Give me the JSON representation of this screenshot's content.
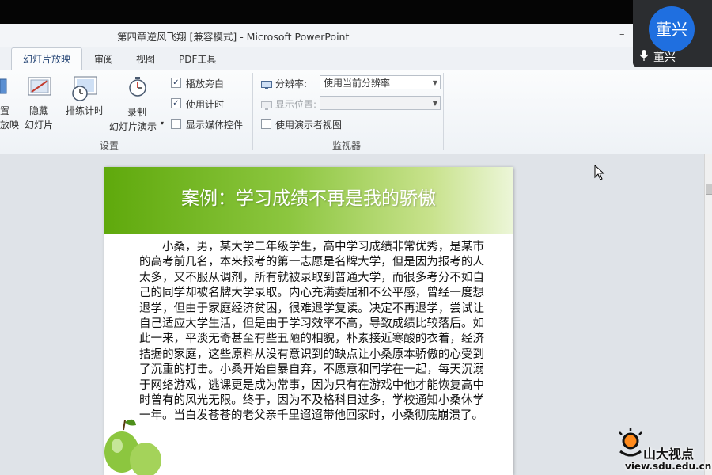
{
  "window": {
    "title": "第四章逆风飞翔 [兼容模式] - Microsoft PowerPoint",
    "minimize": "–",
    "close": "✕"
  },
  "tabs": [
    "幻灯片放映",
    "审阅",
    "视图",
    "PDF工具"
  ],
  "ribbon": {
    "partial_btn_top": "置",
    "partial_btn_bottom": "放映",
    "hide_slide_line1": "隐藏",
    "hide_slide_line2": "幻灯片",
    "rehearse": "排练计时",
    "record_line1": "录制",
    "record_line2": "幻灯片演示",
    "play_narration": "播放旁白",
    "use_timings": "使用计时",
    "show_media_controls": "显示媒体控件",
    "group_setup": "设置",
    "resolution_label": "分辨率:",
    "resolution_value": "使用当前分辨率",
    "show_on_label": "显示位置:",
    "show_on_value": "",
    "presenter_view": "使用演示者视图",
    "group_monitors": "监视器"
  },
  "slide": {
    "title": "案例：学习成绩不再是我的骄傲",
    "body": "小桑，男，某大学二年级学生，高中学习成绩非常优秀，是某市的高考前几名，本来报考的第一志愿是名牌大学，但是因为报考的人太多，又不服从调剂，所有就被录取到普通大学，而很多考分不如自己的同学却被名牌大学录取。内心充满委屈和不公平感，曾经一度想退学，但由于家庭经济贫困，很难退学复读。决定不再退学，尝试让自己适应大学生活，但是由于学习效率不高，导致成绩比较落后。如此一来，平淡无奇甚至有些丑陋的相貌，朴素接近寒酸的衣着，经济拮据的家庭，这些原料从没有意识到的缺点让小桑原本骄傲的心受到了沉重的打击。小桑开始自暴自弃，不愿意和同学在一起，每天沉溺于网络游戏，逃课更是成为常事，因为只有在游戏中他才能恢复高中时曾有的风光无限。终于，因为不及格科目过多，学校通知小桑休学一年。当白发苍苍的老父亲千里迢迢带他回家时，小桑彻底崩溃了。"
  },
  "video": {
    "avatar_text": "董兴",
    "name": "董兴"
  },
  "watermark": {
    "text": "山大视点",
    "url": "view.sdu.edu.cn"
  },
  "colors": {
    "accent": "#1f6fe0",
    "slide_header_green": "#6cb31a"
  }
}
